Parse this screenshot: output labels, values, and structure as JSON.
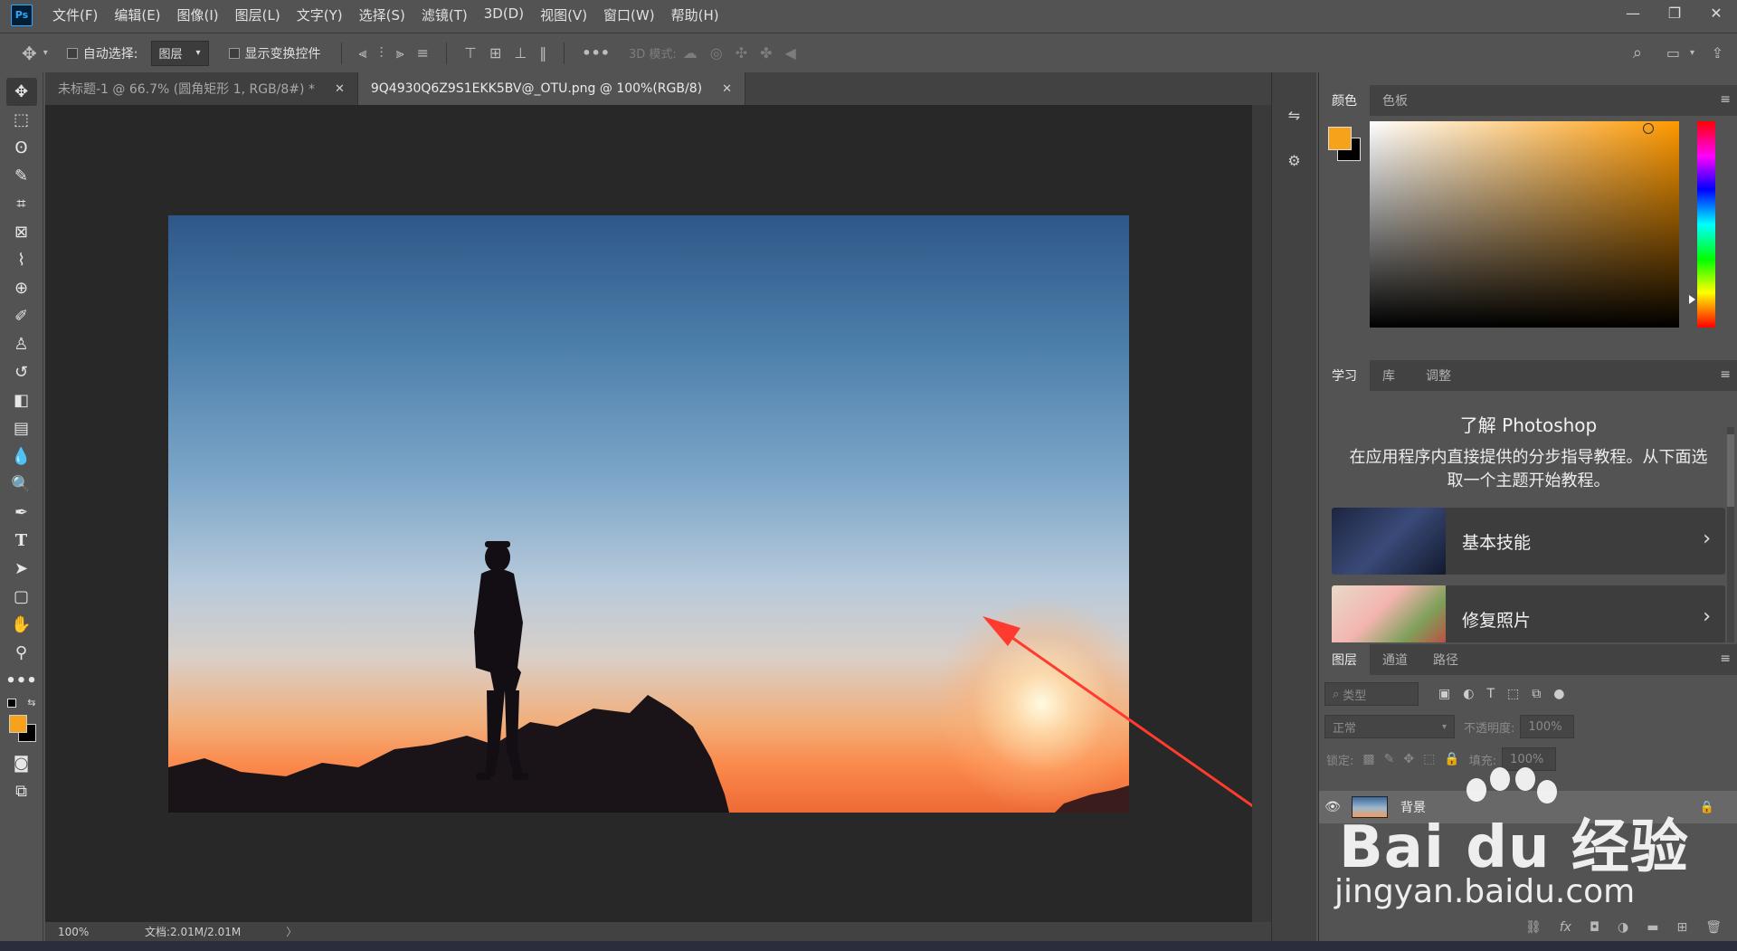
{
  "menubar": {
    "logo": "Ps",
    "items": [
      "文件(F)",
      "编辑(E)",
      "图像(I)",
      "图层(L)",
      "文字(Y)",
      "选择(S)",
      "滤镜(T)",
      "3D(D)",
      "视图(V)",
      "窗口(W)",
      "帮助(H)"
    ],
    "window_controls": [
      "—",
      "❐",
      "✕"
    ]
  },
  "options": {
    "auto_select_label": "自动选择:",
    "auto_select_value": "图层",
    "transform_label": "显示变换控件",
    "mode_3d_label": "3D 模式:"
  },
  "tabs": [
    {
      "title": "未标题-1 @ 66.7% (圆角矩形 1, RGB/8#) *",
      "close": "✕"
    },
    {
      "title": "9Q4930Q6Z9S1EKK5BV@_OTU.png @ 100%(RGB/8)",
      "close": "✕"
    }
  ],
  "status": {
    "zoom": "100%",
    "doc_info": "文档:2.01M/2.01M",
    "arrow": "〉"
  },
  "color_panel": {
    "tabs": [
      "颜色",
      "色板"
    ],
    "foreground": "#f7a21b",
    "background": "#000000"
  },
  "learn_panel": {
    "tabs": [
      "学习",
      "库",
      "调整"
    ],
    "title": "了解 Photoshop",
    "description": "在应用程序内直接提供的分步指导教程。从下面选取一个主题开始教程。",
    "cards": [
      {
        "title": "基本技能"
      },
      {
        "title": "修复照片"
      }
    ]
  },
  "layers_panel": {
    "tabs": [
      "图层",
      "通道",
      "路径"
    ],
    "filter_placeholder": "类型",
    "blend_mode": "正常",
    "opacity_label": "不透明度:",
    "opacity_value": "100%",
    "lock_label": "锁定:",
    "fill_label": "填充:",
    "fill_value": "100%",
    "layers": [
      {
        "name": "背景",
        "visible": true,
        "locked": true
      }
    ]
  },
  "watermark": {
    "brand": "Bai du 经验",
    "url": "jingyan.baidu.com"
  }
}
